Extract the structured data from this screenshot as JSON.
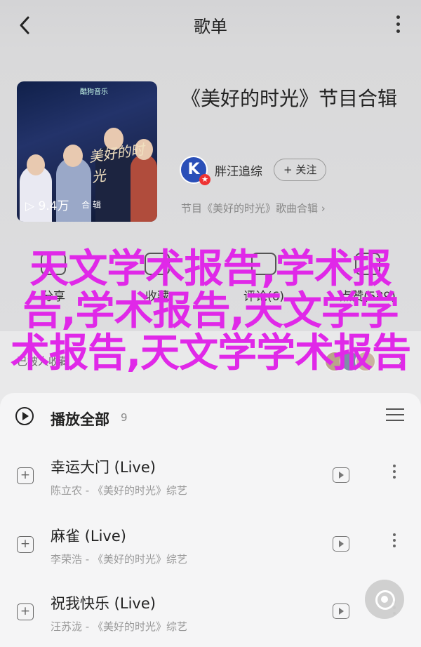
{
  "header": {
    "title": "歌单"
  },
  "album": {
    "title": "《美好的时光》节目合辑",
    "cover_logo": "酷狗音乐",
    "cover_deco": "美好的时光",
    "play_count": "▷ 9.4万",
    "cover_tag": "合 辑",
    "owner": "胖汪追综",
    "follow_label": "+ 关注",
    "source": "节目《美好的时光》歌曲合辑 ›"
  },
  "actions": [
    {
      "label": "分享"
    },
    {
      "label": "收藏"
    },
    {
      "label": "评论(6)"
    },
    {
      "label": "点赞(589)"
    }
  ],
  "listeners": {
    "text": "已被人收藏",
    "chevron": "›"
  },
  "list": {
    "play_all_label": "播放全部",
    "count": "9"
  },
  "songs": [
    {
      "name": "幸运大门 (Live)",
      "subtitle": "陈立农 - 《美好的时光》综艺"
    },
    {
      "name": "麻雀 (Live)",
      "subtitle": "李荣浩 - 《美好的时光》综艺"
    },
    {
      "name": "祝我快乐 (Live)",
      "subtitle": "汪苏泷 - 《美好的时光》综艺"
    }
  ],
  "overlay": {
    "text": "天文学术报告,学术报告,学术报告,天文学学术报告,天文学学术报告"
  },
  "colors": {
    "overlay": "#e028e8",
    "accent_blue": "#2a4fb8"
  }
}
